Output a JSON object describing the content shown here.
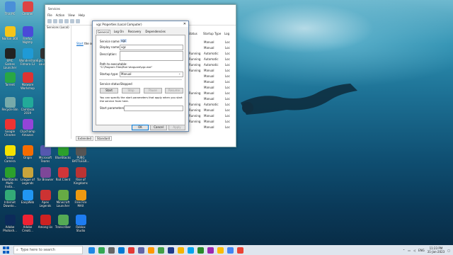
{
  "desktop_icons": [
    {
      "label": "This PC",
      "color": "#4a8fd8"
    },
    {
      "label": "Cleaner",
      "color": "#d44"
    },
    {
      "label": "Norton 360",
      "color": "#f5c518"
    },
    {
      "label": "Firefox Nightly",
      "color": "#4a4ad8"
    },
    {
      "label": "EPIC Games Launcher",
      "color": "#222"
    },
    {
      "label": "Wondershare Filmora 12",
      "color": "#1f9ad6"
    },
    {
      "label": "Epic Games Launcher",
      "color": "#333"
    },
    {
      "label": "Mic...",
      "color": "#1c7"
    },
    {
      "label": "Torrent",
      "color": "#28a745"
    },
    {
      "label": "Malware Workshop",
      "color": "#d33"
    },
    {
      "label": "Recycle Bin",
      "color": "#7aa"
    },
    {
      "label": "Camtasia 2019",
      "color": "#2a9"
    },
    {
      "label": "Google Chrome",
      "color": "#e33"
    },
    {
      "label": "Clipchamp Amazon",
      "color": "#9444d8"
    },
    {
      "label": "Snap Camera",
      "color": "#f5e200"
    },
    {
      "label": "Origin",
      "color": "#f56c00"
    },
    {
      "label": "Microsoft Teams",
      "color": "#5558af"
    },
    {
      "label": "BlueStacks",
      "color": "#2ca02c"
    },
    {
      "label": "PUBG BATTLEGR...",
      "color": "#555"
    },
    {
      "label": "BlueStacks Multi-Insta...",
      "color": "#2ca02c"
    },
    {
      "label": "League of Legends",
      "color": "#c9a43c"
    },
    {
      "label": "Tor Browser",
      "color": "#7e4798"
    },
    {
      "label": "Riot Client",
      "color": "#d13639"
    },
    {
      "label": "Rise of Kingdoms",
      "color": "#b33"
    },
    {
      "label": "Internet Downlo...",
      "color": "#3a7"
    },
    {
      "label": "EasyWeb",
      "color": "#2196f3"
    },
    {
      "label": "Apex Legends",
      "color": "#c33"
    },
    {
      "label": "Minecraft Launcher",
      "color": "#6a4"
    },
    {
      "label": "Free Fire MAX",
      "color": "#e91"
    },
    {
      "label": "Adobe Photosh...",
      "color": "#0c2b5a"
    },
    {
      "label": "Adobe Creati...",
      "color": "#e23"
    },
    {
      "label": "Among Us",
      "color": "#c22"
    },
    {
      "label": "Transcriber",
      "color": "#5a5"
    },
    {
      "label": "Roblox Studio",
      "color": "#1e7cf0"
    }
  ],
  "services_window": {
    "title": "Services",
    "menu": [
      "File",
      "Action",
      "View",
      "Help"
    ],
    "left_pane": "Services (Local)",
    "link": "Start",
    "link_suffix": "the servi...",
    "columns": [
      "Status",
      "Startup Type",
      "Log"
    ],
    "rows": [
      [
        "",
        "Manual",
        "Loc"
      ],
      [
        "",
        "Manual",
        "Loc"
      ],
      [
        "Running",
        "Automatic",
        "Loc"
      ],
      [
        "Running",
        "Automatic",
        "Loc"
      ],
      [
        "Running",
        "Automatic",
        "Loc"
      ],
      [
        "Running",
        "Manual",
        "Loc"
      ],
      [
        "",
        "Manual",
        "Loc"
      ],
      [
        "",
        "Manual",
        "Loc"
      ],
      [
        "",
        "Manual",
        "Loc"
      ],
      [
        "Running",
        "Manual",
        "Loc"
      ],
      [
        "",
        "Manual",
        "Loc"
      ],
      [
        "Running",
        "Automatic",
        "Loc"
      ],
      [
        "Running",
        "Manual",
        "Loc"
      ],
      [
        "Running",
        "Manual",
        "Loc"
      ],
      [
        "Running",
        "Manual",
        "Loc"
      ],
      [
        "",
        "Manual",
        "Loc"
      ]
    ],
    "bottom_tabs": [
      "Extended",
      "Standard"
    ]
  },
  "dialog": {
    "title": "vgc Properties (Local Computer)",
    "tabs": [
      "General",
      "Log On",
      "Recovery",
      "Dependencies"
    ],
    "service_name_label": "Service name:",
    "service_name": "vgc",
    "display_name_label": "Display name:",
    "display_name": "vgc",
    "description_label": "Description:",
    "path_label": "Path to executable:",
    "path": "\"C:\\Program Files\\Riot Vanguard\\vgc.exe\"",
    "startup_type_label": "Startup type:",
    "startup_type": "Manual",
    "service_status_label": "Service status:",
    "service_status": "Stopped",
    "buttons": [
      "Start",
      "Stop",
      "Pause",
      "Resume"
    ],
    "help_text": "You can specify the start parameters that apply when you start the service from here.",
    "start_params_label": "Start parameters:",
    "ok": "OK",
    "cancel": "Cancel",
    "apply": "Apply"
  },
  "taskbar": {
    "search_placeholder": "Type here to search",
    "icons": [
      "#1e88e5",
      "#34a853",
      "#666",
      "#0078d4",
      "#e53935",
      "#6264a7",
      "#ff9800",
      "#43a047",
      "#1e3a8a",
      "#f4b400",
      "#00a4ef",
      "#2a8a2a",
      "#9c27b0",
      "#fbbc05",
      "#4285f4",
      "#ea4335"
    ],
    "lang": "ENG",
    "time": "11:23 PM",
    "date": "31-Jan-2023"
  }
}
